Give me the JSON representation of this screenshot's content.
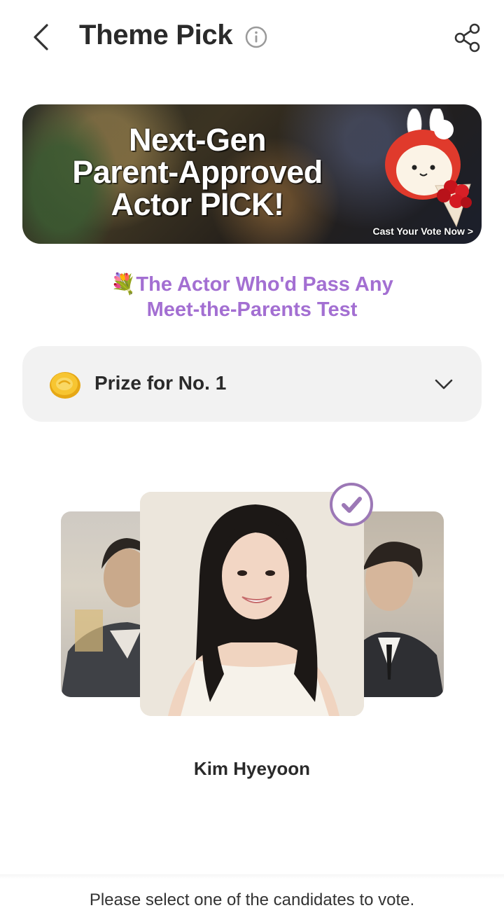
{
  "header": {
    "title": "Theme Pick",
    "back_icon": "chevron-left-icon",
    "info_icon": "info-icon",
    "share_icon": "share-icon"
  },
  "banner": {
    "line1": "Next-Gen",
    "line2": "Parent-Approved",
    "line3": "Actor PICK!",
    "cta": "Cast Your Vote Now >"
  },
  "subtitle": {
    "emoji": "💐",
    "line1": "The Actor Who'd Pass Any",
    "line2": "Meet-the-Parents Test"
  },
  "prize": {
    "label": "Prize for No. 1",
    "icon": "coin-icon",
    "expand_icon": "chevron-down-icon"
  },
  "candidate": {
    "selected_name": "Kim Hyeyoon",
    "selected": true
  },
  "footer": {
    "instruction": "Please select one of the candidates to vote."
  },
  "colors": {
    "accent_purple": "#a36fd2",
    "check_purple": "#9c78b6",
    "prize_bg": "#f2f2f2"
  }
}
